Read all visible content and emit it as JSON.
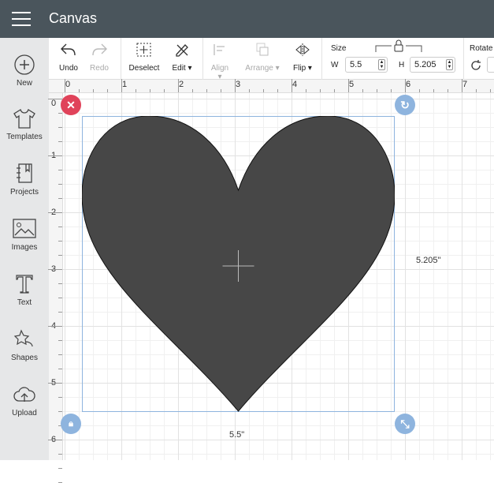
{
  "header": {
    "title": "Canvas"
  },
  "sidebar": {
    "items": [
      {
        "label": "New",
        "icon": "plus-circle-icon"
      },
      {
        "label": "Templates",
        "icon": "tshirt-icon"
      },
      {
        "label": "Projects",
        "icon": "notebook-icon"
      },
      {
        "label": "Images",
        "icon": "image-icon"
      },
      {
        "label": "Text",
        "icon": "text-icon"
      },
      {
        "label": "Shapes",
        "icon": "shapes-icon"
      },
      {
        "label": "Upload",
        "icon": "cloud-upload-icon"
      }
    ]
  },
  "toolbar": {
    "undo": "Undo",
    "redo": "Redo",
    "deselect": "Deselect",
    "edit": "Edit",
    "align": "Align",
    "arrange": "Arrange",
    "flip": "Flip",
    "size_label": "Size",
    "w_label": "W",
    "w_value": "5.5",
    "h_label": "H",
    "h_value": "5.205",
    "rotate_label": "Rotate"
  },
  "ruler": {
    "h": [
      "0",
      "1",
      "2",
      "3",
      "4",
      "5",
      "6",
      "7"
    ],
    "v": [
      "0",
      "1",
      "2",
      "3",
      "4",
      "5",
      "6"
    ]
  },
  "selection": {
    "width_label": "5.5\"",
    "height_label": "5.205\"",
    "shape_color": "#474747",
    "selection_color": "#8eb4de",
    "delete_color": "#e0435a"
  }
}
